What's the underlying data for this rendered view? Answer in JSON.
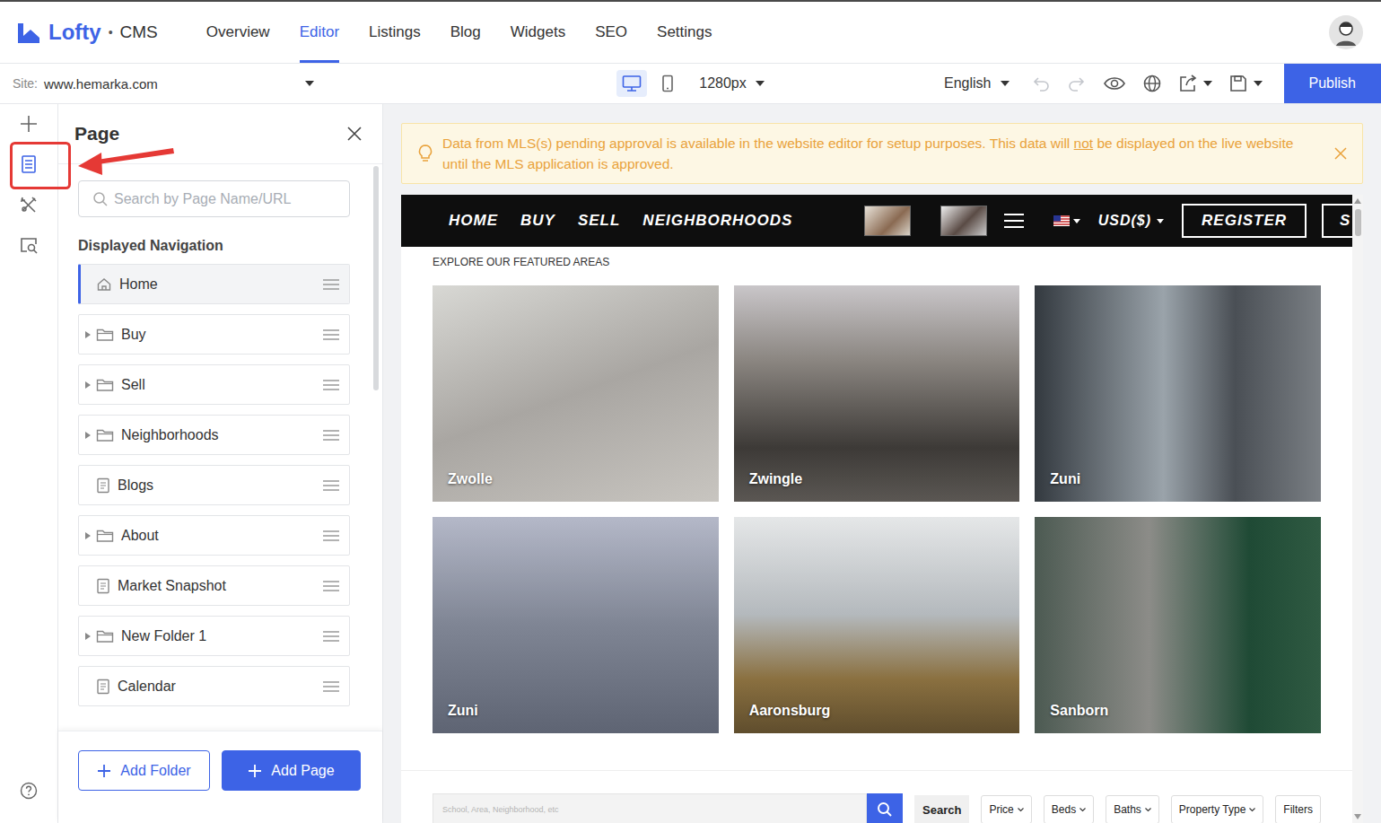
{
  "app": {
    "brand": "Lofty",
    "separator": "•",
    "product": "CMS"
  },
  "nav": [
    {
      "label": "Overview",
      "selected": false
    },
    {
      "label": "Editor",
      "selected": true
    },
    {
      "label": "Listings",
      "selected": false
    },
    {
      "label": "Blog",
      "selected": false
    },
    {
      "label": "Widgets",
      "selected": false
    },
    {
      "label": "SEO",
      "selected": false
    },
    {
      "label": "Settings",
      "selected": false
    }
  ],
  "toolbar": {
    "site_label": "Site:",
    "site": "www.hemarka.com",
    "devices": [
      {
        "kind": "desktop",
        "selected": true
      },
      {
        "kind": "mobile",
        "selected": false
      }
    ],
    "width": "1280px",
    "language": "English",
    "actions": [
      {
        "kind": "undo",
        "disabled": true,
        "dropdown": false
      },
      {
        "kind": "redo",
        "disabled": true,
        "dropdown": false
      },
      {
        "kind": "preview",
        "disabled": false,
        "dropdown": false
      },
      {
        "kind": "globe",
        "disabled": false,
        "dropdown": false
      },
      {
        "kind": "share",
        "disabled": false,
        "dropdown": true
      },
      {
        "kind": "save",
        "disabled": false,
        "dropdown": true
      }
    ],
    "publish": "Publish"
  },
  "rail": [
    {
      "kind": "add",
      "selected": false
    },
    {
      "kind": "pages",
      "selected": true
    },
    {
      "kind": "tools",
      "selected": false
    },
    {
      "kind": "seo",
      "selected": false
    },
    {
      "kind": "help",
      "selected": false
    }
  ],
  "panel": {
    "title": "Page",
    "search_placeholder": "Search by Page Name/URL",
    "section": "Displayed Navigation",
    "items": [
      {
        "label": "Home",
        "kind": "home",
        "selected": true
      },
      {
        "label": "Buy",
        "kind": "folder",
        "selected": false
      },
      {
        "label": "Sell",
        "kind": "folder",
        "selected": false
      },
      {
        "label": "Neighborhoods",
        "kind": "folder",
        "selected": false
      },
      {
        "label": "Blogs",
        "kind": "page",
        "selected": false
      },
      {
        "label": "About",
        "kind": "folder",
        "selected": false
      },
      {
        "label": "Market Snapshot",
        "kind": "page",
        "selected": false
      },
      {
        "label": "New Folder 1",
        "kind": "folder",
        "selected": false
      },
      {
        "label": "Calendar",
        "kind": "page",
        "selected": false
      }
    ],
    "buttons": [
      {
        "label": "Add Folder",
        "kind": "secondary"
      },
      {
        "label": "Add Page",
        "kind": "primary"
      }
    ]
  },
  "notice": {
    "before": "Data from MLS(s) pending approval is available in the website editor for setup purposes. This data will ",
    "emphasis": "not",
    "after": " be displayed on the live website until the MLS application is approved."
  },
  "preview": {
    "menu": [
      "HOME",
      "BUY",
      "SELL",
      "NEIGHBORHOODS"
    ],
    "currency": "USD($)",
    "register": "REGISTER",
    "cut_item": "S",
    "heading": "EXPLORE OUR FEATURED AREAS",
    "areas": [
      "Zwolle",
      "Zwingle",
      "Zuni",
      "Zuni",
      "Aaronsburg",
      "Sanborn"
    ],
    "search": {
      "placeholder": "School, Area, Neighborhood, etc",
      "button": "Search",
      "filters": [
        {
          "label": "Price",
          "dropdown": true
        },
        {
          "label": "Beds",
          "dropdown": true
        },
        {
          "label": "Baths",
          "dropdown": true
        },
        {
          "label": "Property Type",
          "dropdown": true
        },
        {
          "label": "Filters",
          "dropdown": false
        }
      ]
    }
  }
}
